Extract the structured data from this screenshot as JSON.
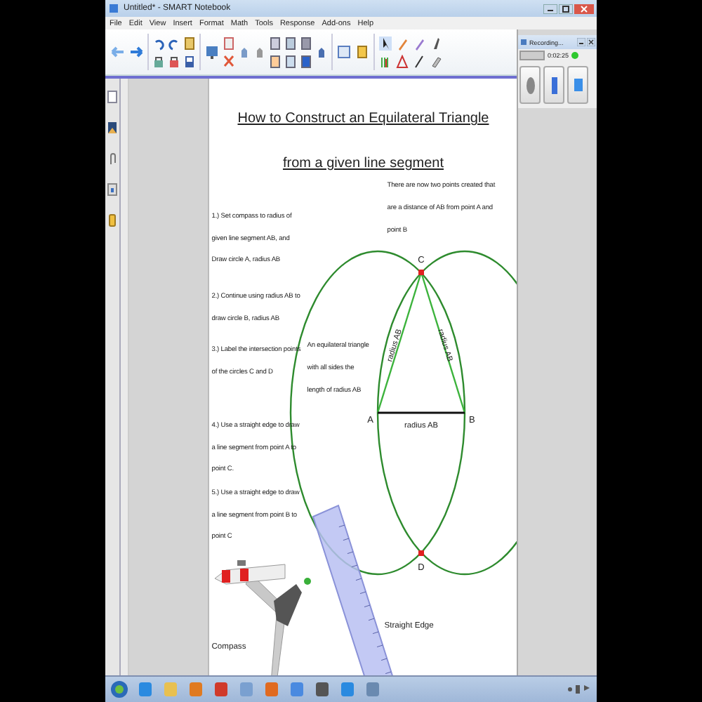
{
  "window": {
    "title": "Untitled* - SMART Notebook"
  },
  "menu": [
    "File",
    "Edit",
    "View",
    "Insert",
    "Format",
    "Math",
    "Tools",
    "Response",
    "Add-ons",
    "Help"
  ],
  "recorder": {
    "title": "Recording...",
    "time": "0:02:25"
  },
  "page": {
    "title_lines": [
      "How to Construct an Equilateral Triangle",
      "from a given line segment"
    ],
    "steps": [
      "1.) Set compass to radius of given line segment AB, and Draw circle A, radius AB",
      "2.) Continue using radius AB to draw circle B, radius AB",
      "3.) Label the intersection points of the circles C and D",
      "4.) Use a straight edge to draw a line segment from point A to point C.",
      "5.) Use a straight edge to draw a line segment from point B to point C"
    ],
    "note_top": "There are now two points created that are a distance of AB from point A and point B",
    "note_middle": "An equilateral triangle with all sides the length of radius AB",
    "points": [
      "C",
      "A",
      "B",
      "D"
    ],
    "side_labels": [
      "radius AB",
      "radius AB",
      "radius AB"
    ],
    "tool_labels": [
      "Compass",
      "Straight Edge"
    ]
  }
}
